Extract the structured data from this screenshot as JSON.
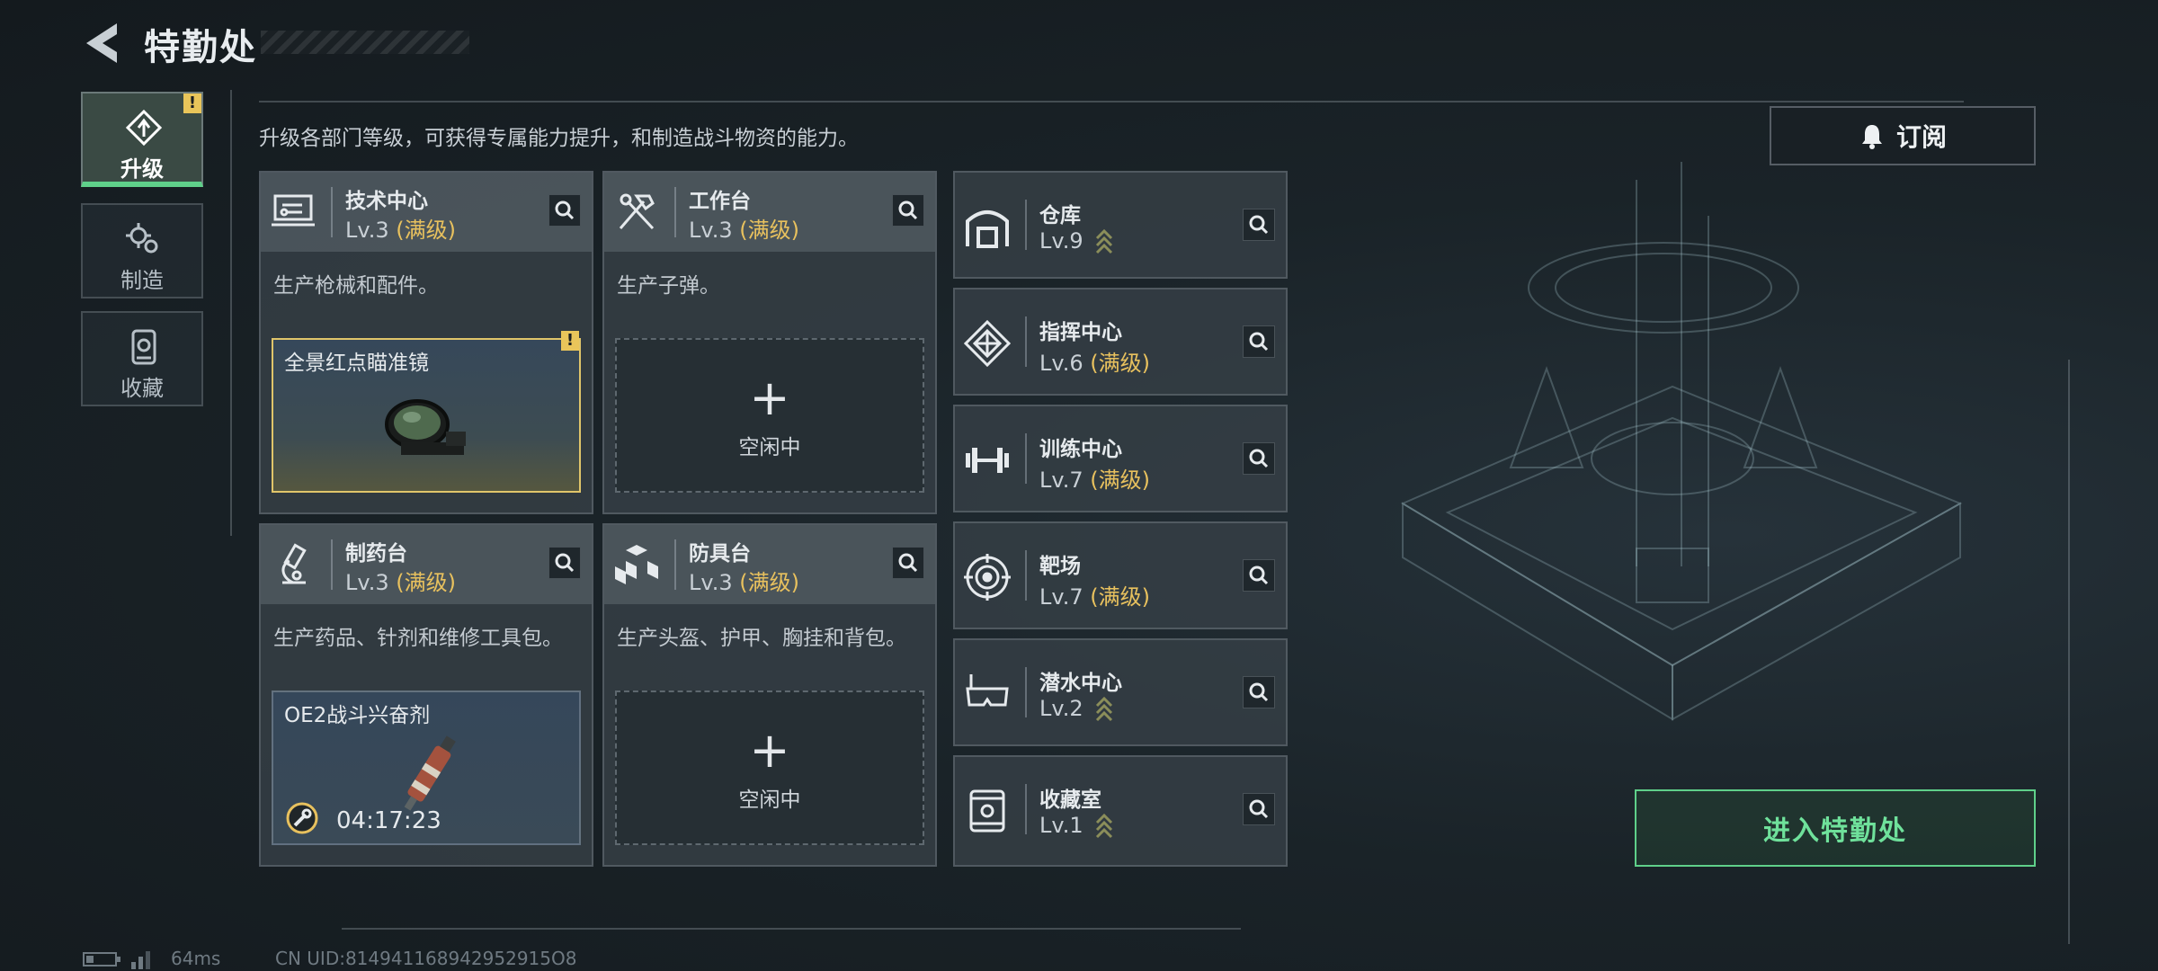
{
  "header": {
    "title": "特勤处"
  },
  "nav": [
    {
      "label": "升级",
      "icon": "upgrade-icon",
      "active": true,
      "badge": "!"
    },
    {
      "label": "制造",
      "icon": "gears-icon",
      "active": false
    },
    {
      "label": "收藏",
      "icon": "collection-icon",
      "active": false
    }
  ],
  "subtitle": "升级各部门等级，可获得专属能力提升，和制造战斗物资的能力。",
  "subscribe": {
    "label": "订阅",
    "icon": "bell-icon"
  },
  "production": [
    {
      "name": "技术中心",
      "level": "Lv.3",
      "max": "(满级)",
      "desc": "生产枪械和配件。",
      "icon": "tech-center-icon",
      "slot": {
        "type": "item",
        "name": "全景红点瞄准镜",
        "badge": "!"
      }
    },
    {
      "name": "工作台",
      "level": "Lv.3",
      "max": "(满级)",
      "desc": "生产子弹。",
      "icon": "workbench-icon",
      "slot": {
        "type": "empty",
        "plus": "+",
        "status": "空闲中"
      }
    },
    {
      "name": "制药台",
      "level": "Lv.3",
      "max": "(满级)",
      "desc": "生产药品、针剂和维修工具包。",
      "icon": "pharmacy-icon",
      "slot": {
        "type": "item",
        "name": "OE2战斗兴奋剂",
        "timer": "04:17:23"
      }
    },
    {
      "name": "防具台",
      "level": "Lv.3",
      "max": "(满级)",
      "desc": "生产头盔、护甲、胸挂和背包。",
      "icon": "armor-bench-icon",
      "slot": {
        "type": "empty",
        "plus": "+",
        "status": "空闲中"
      }
    }
  ],
  "facilities": [
    {
      "name": "仓库",
      "level": "Lv.9",
      "max": "",
      "upgradable": true,
      "icon": "warehouse-icon"
    },
    {
      "name": "指挥中心",
      "level": "Lv.6",
      "max": "(满级)",
      "upgradable": false,
      "icon": "command-center-icon"
    },
    {
      "name": "训练中心",
      "level": "Lv.7",
      "max": "(满级)",
      "upgradable": false,
      "icon": "training-center-icon"
    },
    {
      "name": "靶场",
      "level": "Lv.7",
      "max": "(满级)",
      "upgradable": false,
      "icon": "shooting-range-icon"
    },
    {
      "name": "潜水中心",
      "level": "Lv.2",
      "max": "",
      "upgradable": true,
      "icon": "diving-center-icon"
    },
    {
      "name": "收藏室",
      "level": "Lv.1",
      "max": "",
      "upgradable": true,
      "icon": "collection-room-icon"
    }
  ],
  "enter_button": "进入特勤处",
  "status_bar": {
    "ping": "64ms",
    "uid": "CN UID:814941168942952915O8"
  },
  "colors": {
    "accent_green": "#5fd08a",
    "max_level_gold": "#e8c15e",
    "badge_yellow": "#e9c55a"
  }
}
